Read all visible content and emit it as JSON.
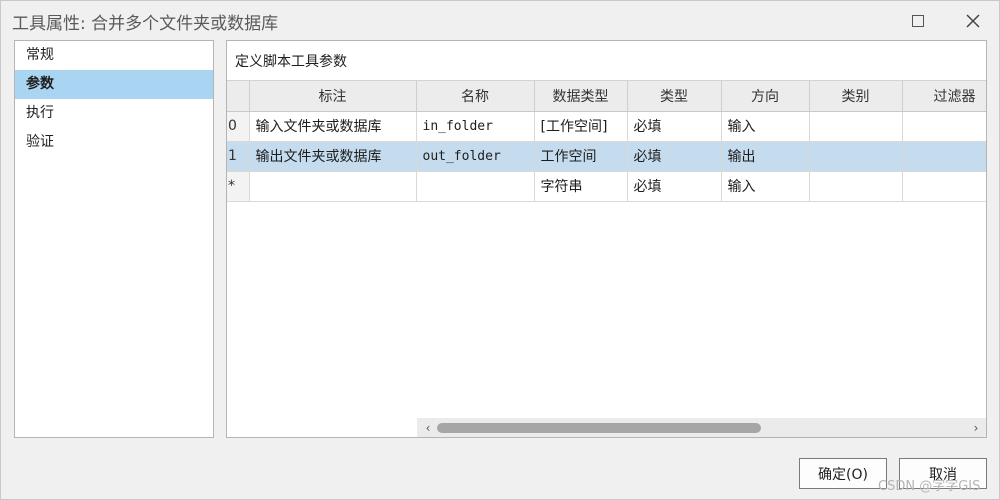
{
  "window": {
    "title": "工具属性: 合并多个文件夹或数据库",
    "maximize_icon": "maximize-icon",
    "close_icon": "close-icon"
  },
  "sidebar": {
    "items": [
      {
        "label": "常规",
        "active": false
      },
      {
        "label": "参数",
        "active": true
      },
      {
        "label": "执行",
        "active": false
      },
      {
        "label": "验证",
        "active": false
      }
    ]
  },
  "main": {
    "title": "定义脚本工具参数",
    "columns": [
      "",
      "标注",
      "名称",
      "数据类型",
      "类型",
      "方向",
      "类别",
      "过滤器"
    ],
    "rows": [
      {
        "index": "0",
        "label": "输入文件夹或数据库",
        "name": "in_folder",
        "datatype": "[工作空间]",
        "type": "必填",
        "direction": "输入",
        "category": "",
        "filter": ""
      },
      {
        "index": "1",
        "label": "输出文件夹或数据库",
        "name": "out_folder",
        "datatype": "工作空间",
        "type": "必填",
        "direction": "输出",
        "category": "",
        "filter": ""
      },
      {
        "index": "*",
        "label": "",
        "name": "",
        "datatype": "字符串",
        "type": "必填",
        "direction": "输入",
        "category": "",
        "filter": ""
      }
    ],
    "selected_row": 1
  },
  "buttons": {
    "ok": "确定(O)",
    "cancel": "取消"
  },
  "watermark": "CSDN @字字GIS",
  "colors": {
    "selection": "#a9d5f3",
    "row_selection": "#c5dcee"
  }
}
